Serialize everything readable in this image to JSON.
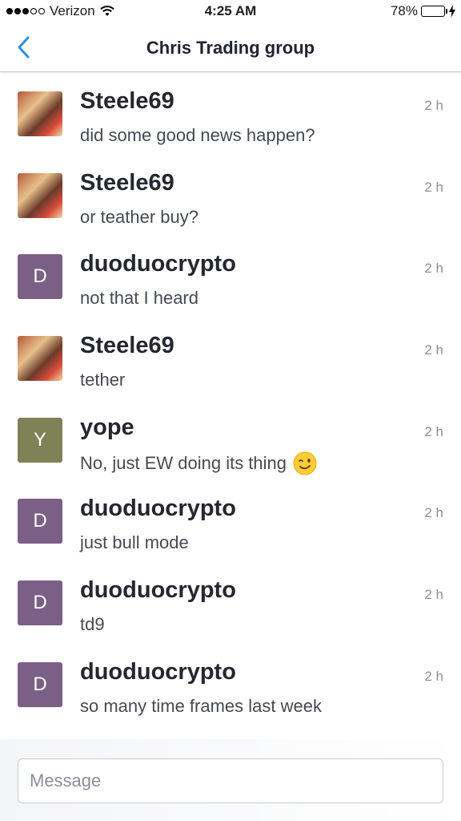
{
  "status": {
    "carrier": "Verizon",
    "time": "4:25 AM",
    "battery": "78%",
    "battery_level": 0.78
  },
  "nav": {
    "title": "Chris Trading group"
  },
  "messages": [
    {
      "sender": "Steele69",
      "avatar": "",
      "avatar_color": "photo",
      "text": "did some good news happen?",
      "time": "2 h"
    },
    {
      "sender": "Steele69",
      "avatar": "",
      "avatar_color": "photo",
      "text": "or teather buy?",
      "time": "2 h"
    },
    {
      "sender": "duoduocrypto",
      "avatar": "D",
      "avatar_color": "#7b5f86",
      "text": "not that I heard",
      "time": "2 h"
    },
    {
      "sender": "Steele69",
      "avatar": "",
      "avatar_color": "photo",
      "text": "tether",
      "time": "2 h"
    },
    {
      "sender": "yope",
      "avatar": "Y",
      "avatar_color": "#7d8357",
      "text": "No, just EW doing its thing",
      "time": "2 h",
      "emoji": "winking-face"
    },
    {
      "sender": "duoduocrypto",
      "avatar": "D",
      "avatar_color": "#7b5f86",
      "text": "just bull mode",
      "time": "2 h"
    },
    {
      "sender": "duoduocrypto",
      "avatar": "D",
      "avatar_color": "#7b5f86",
      "text": "td9",
      "time": "2 h"
    },
    {
      "sender": "duoduocrypto",
      "avatar": "D",
      "avatar_color": "#7b5f86",
      "text": "so many time frames last week",
      "time": "2 h"
    }
  ],
  "composer": {
    "placeholder": "Message"
  },
  "colors": {
    "accent": "#2f8ee0",
    "battery": "#4cd964"
  }
}
